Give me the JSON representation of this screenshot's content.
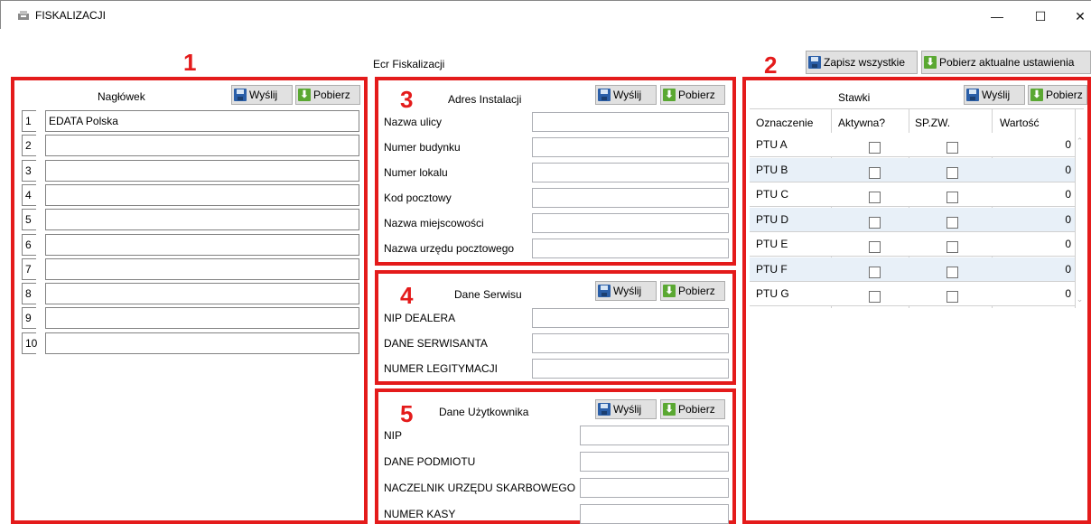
{
  "window": {
    "title": "FISKALIZACJI",
    "minimize": "—",
    "maximize": "☐",
    "close": "✕"
  },
  "section_labels": [
    "1",
    "2",
    "3",
    "4",
    "5"
  ],
  "ecr_label": "Ecr Fiskalizacji",
  "top_buttons": {
    "save_all": "Zapisz wszystkie",
    "fetch_current": "Pobierz aktualne ustawienia"
  },
  "buttons": {
    "send": "Wyślij",
    "fetch": "Pobierz"
  },
  "header_panel": {
    "title": "Nagłówek",
    "rows": [
      {
        "num": "1",
        "value": "EDATA Polska"
      },
      {
        "num": "2",
        "value": ""
      },
      {
        "num": "3",
        "value": ""
      },
      {
        "num": "4",
        "value": ""
      },
      {
        "num": "5",
        "value": ""
      },
      {
        "num": "6",
        "value": ""
      },
      {
        "num": "7",
        "value": ""
      },
      {
        "num": "8",
        "value": ""
      },
      {
        "num": "9",
        "value": ""
      },
      {
        "num": "10",
        "value": ""
      }
    ]
  },
  "address_panel": {
    "title": "Adres Instalacji",
    "fields": [
      "Nazwa ulicy",
      "Numer budynku",
      "Numer lokalu",
      "Kod pocztowy",
      "Nazwa miejscowości",
      "Nazwa urzędu pocztowego"
    ]
  },
  "service_panel": {
    "title": "Dane Serwisu",
    "fields": [
      "NIP DEALERA",
      "DANE SERWISANTA",
      "NUMER LEGITYMACJI"
    ]
  },
  "user_panel": {
    "title": "Dane Użytkownika",
    "fields": [
      "NIP",
      "DANE PODMIOTU",
      "NACZELNIK URZĘDU SKARBOWEGO",
      "NUMER KASY"
    ]
  },
  "rates_panel": {
    "title": "Stawki",
    "columns": [
      "Oznaczenie",
      "Aktywna?",
      "SP.ZW.",
      "Wartość"
    ],
    "rows": [
      {
        "name": "PTU A",
        "active": false,
        "exempt": false,
        "value": "0"
      },
      {
        "name": "PTU B",
        "active": false,
        "exempt": false,
        "value": "0"
      },
      {
        "name": "PTU C",
        "active": false,
        "exempt": false,
        "value": "0"
      },
      {
        "name": "PTU D",
        "active": false,
        "exempt": false,
        "value": "0"
      },
      {
        "name": "PTU E",
        "active": false,
        "exempt": false,
        "value": "0"
      },
      {
        "name": "PTU F",
        "active": false,
        "exempt": false,
        "value": "0"
      },
      {
        "name": "PTU G",
        "active": false,
        "exempt": false,
        "value": "0"
      }
    ]
  },
  "colors": {
    "annotation_red": "#e41b1b",
    "alt_row": "#e8f0f8",
    "save_icon": "#2b5fa8",
    "download_icon": "#5aa832"
  }
}
